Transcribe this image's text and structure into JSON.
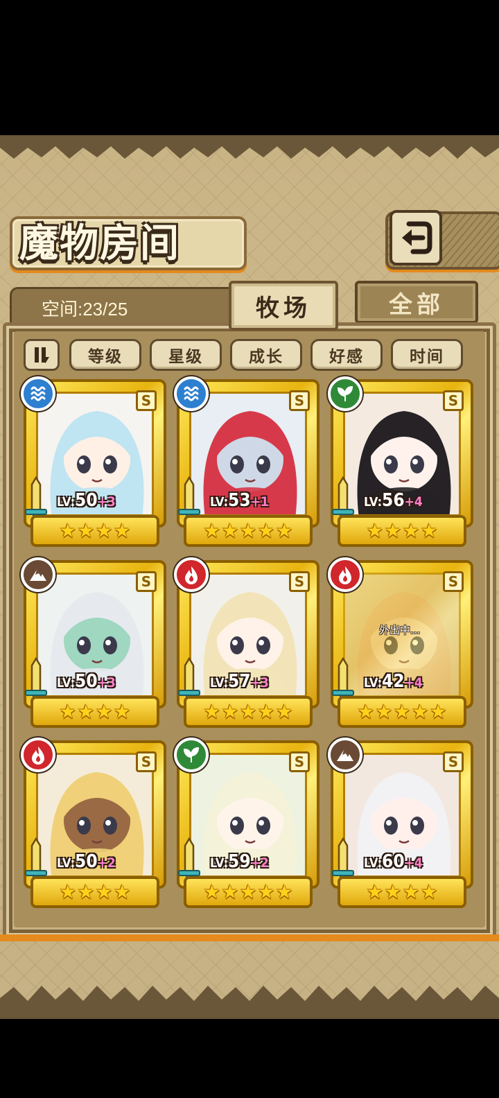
{
  "header": {
    "title": "魔物房间",
    "back_icon": "return-arrow-icon"
  },
  "space": {
    "label": "空间:23/25"
  },
  "tabs": [
    {
      "label": "牧场",
      "active": true
    },
    {
      "label": "全部",
      "active": false
    }
  ],
  "sort": {
    "toggle_icon": "sort-direction-icon",
    "buttons": [
      "等级",
      "星级",
      "成长",
      "好感",
      "时间"
    ]
  },
  "monsters": [
    {
      "element": "water",
      "rank": "S",
      "level": "50",
      "bonus": "+3",
      "stars": 4,
      "hair": "#bfe4f2",
      "skin": "#fff0e6",
      "bg": "#f6f4f0",
      "away": false
    },
    {
      "element": "water",
      "rank": "S",
      "level": "53",
      "bonus": "+1",
      "stars": 5,
      "hair": "#d63a4a",
      "skin": "#cfd8e6",
      "bg": "#e8eef3",
      "away": false
    },
    {
      "element": "wood",
      "rank": "S",
      "level": "56",
      "bonus": "+4",
      "stars": 4,
      "hair": "#262226",
      "skin": "#fff2ec",
      "bg": "#f4eae0",
      "away": false
    },
    {
      "element": "earth",
      "rank": "S",
      "level": "50",
      "bonus": "+3",
      "stars": 4,
      "hair": "#e6eaee",
      "skin": "#9fd7c0",
      "bg": "#eef2f0",
      "away": false
    },
    {
      "element": "fire",
      "rank": "S",
      "level": "57",
      "bonus": "+3",
      "stars": 5,
      "hair": "#f2e4b8",
      "skin": "#fff2e8",
      "bg": "#f2f0ea",
      "away": false
    },
    {
      "element": "fire",
      "rank": "S",
      "level": "42",
      "bonus": "+4",
      "stars": 5,
      "hair": "#e7c0a2",
      "skin": "#f6dcc8",
      "bg": "#e2cfb0",
      "away": true,
      "away_text": "外出中..."
    },
    {
      "element": "fire",
      "rank": "S",
      "level": "50",
      "bonus": "+2",
      "stars": 4,
      "hair": "#f0d078",
      "skin": "#9a6a44",
      "bg": "#f4ecd8",
      "away": false
    },
    {
      "element": "wood",
      "rank": "S",
      "level": "59",
      "bonus": "+2",
      "stars": 5,
      "hair": "#f4f2d8",
      "skin": "#fff4ea",
      "bg": "#eef2e0",
      "away": false
    },
    {
      "element": "earth",
      "rank": "S",
      "level": "60",
      "bonus": "+4",
      "stars": 4,
      "hair": "#f2f2f4",
      "skin": "#fff0ec",
      "bg": "#f3e8e0",
      "away": false
    }
  ],
  "level_prefix": "LV:"
}
